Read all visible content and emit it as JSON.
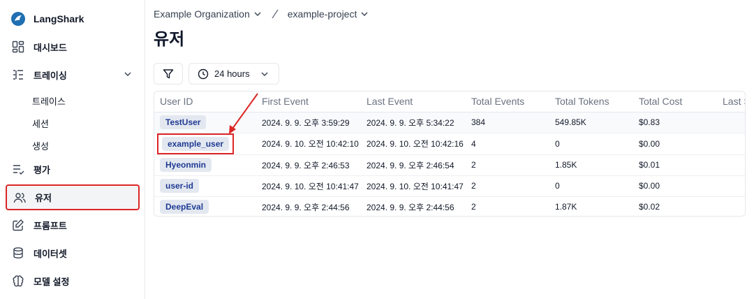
{
  "brand": {
    "name": "LangShark"
  },
  "sidebar": {
    "items": [
      {
        "label": "대시보드",
        "icon": "dashboard-icon"
      },
      {
        "label": "트레이싱",
        "icon": "tracing-icon",
        "expanded": true
      },
      {
        "label": "평가",
        "icon": "evaluation-icon"
      },
      {
        "label": "유저",
        "icon": "users-icon",
        "active": true
      },
      {
        "label": "프롬프트",
        "icon": "prompt-icon"
      },
      {
        "label": "데이터셋",
        "icon": "database-icon"
      },
      {
        "label": "모델 설정",
        "icon": "brain-icon"
      }
    ],
    "subitems": [
      "트레이스",
      "세션",
      "생성"
    ]
  },
  "breadcrumb": {
    "org": "Example Organization",
    "project": "example-project"
  },
  "page": {
    "title": "유저"
  },
  "toolbar": {
    "time_range": "24 hours"
  },
  "table": {
    "headers": [
      "User ID",
      "First Event",
      "Last Event",
      "Total Events",
      "Total Tokens",
      "Total Cost",
      "Last S"
    ],
    "rows": [
      {
        "user": "TestUser",
        "first": "2024. 9. 9. 오후 3:59:29",
        "last": "2024. 9. 9. 오후 5:34:22",
        "events": "384",
        "tokens": "549.85K",
        "cost": "$0.83"
      },
      {
        "user": "example_user",
        "first": "2024. 9. 10. 오전 10:42:10",
        "last": "2024. 9. 10. 오전 10:42:16",
        "events": "4",
        "tokens": "0",
        "cost": "$0.00"
      },
      {
        "user": "Hyeonmin",
        "first": "2024. 9. 9. 오후 2:46:53",
        "last": "2024. 9. 9. 오후 2:46:54",
        "events": "2",
        "tokens": "1.85K",
        "cost": "$0.01"
      },
      {
        "user": "user-id",
        "first": "2024. 9. 10. 오전 10:41:47",
        "last": "2024. 9. 10. 오전 10:41:47",
        "events": "2",
        "tokens": "0",
        "cost": "$0.00"
      },
      {
        "user": "DeepEval",
        "first": "2024. 9. 9. 오후 2:44:56",
        "last": "2024. 9. 9. 오후 2:44:56",
        "events": "2",
        "tokens": "1.87K",
        "cost": "$0.02"
      }
    ]
  },
  "colors": {
    "highlight": "#dc2626",
    "brand": "#1f6fb2",
    "badge_bg": "#e3e8f0",
    "badge_text": "#1f3a93"
  }
}
